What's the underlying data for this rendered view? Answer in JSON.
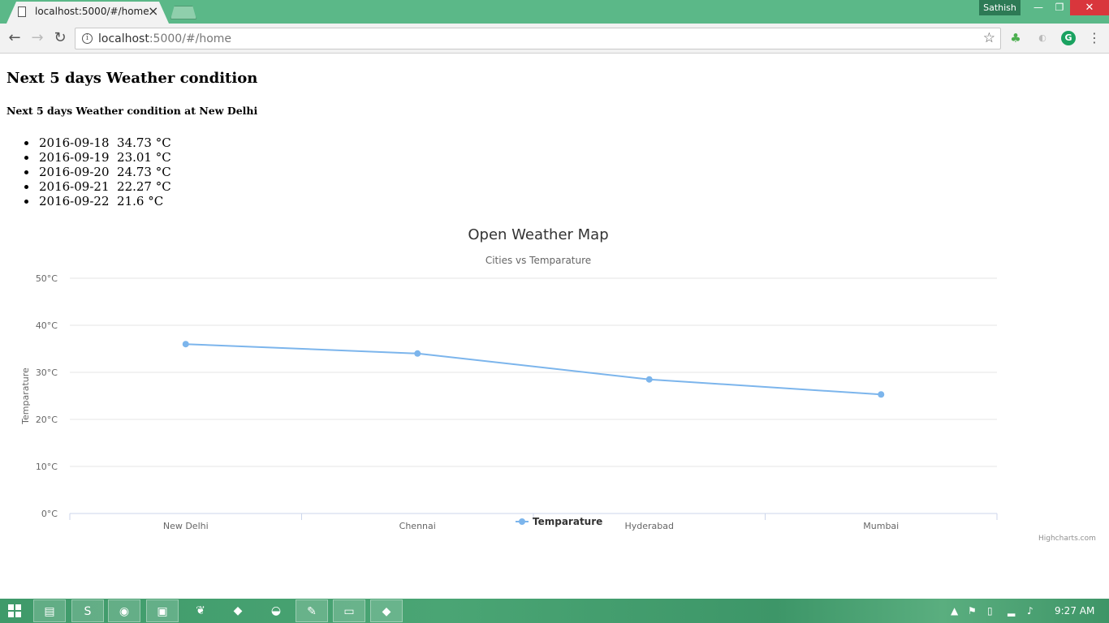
{
  "browser": {
    "tab_title": "localhost:5000/#/home",
    "profile_name": "Sathish",
    "url_host": "localhost",
    "url_rest": ":5000/#/home",
    "close_glyph": "✕",
    "min_glyph": "—",
    "max_glyph": "❐",
    "tab_close_glyph": "×"
  },
  "page": {
    "heading": "Next 5 days Weather condition",
    "subheading": "Next 5 days Weather condition at New Delhi",
    "forecast": [
      {
        "date": "2016-09-18",
        "temp": "34.73 °C"
      },
      {
        "date": "2016-09-19",
        "temp": "23.01 °C"
      },
      {
        "date": "2016-09-20",
        "temp": "24.73 °C"
      },
      {
        "date": "2016-09-21",
        "temp": "22.27 °C"
      },
      {
        "date": "2016-09-22",
        "temp": "21.6 °C"
      }
    ]
  },
  "chart_data": {
    "type": "line",
    "title": "Open Weather Map",
    "subtitle": "Cities vs Temparature",
    "ylabel": "Temparature",
    "xlabel": "",
    "categories": [
      "New Delhi",
      "Chennai",
      "Hyderabad",
      "Mumbai"
    ],
    "yticks": [
      "0°C",
      "10°C",
      "20°C",
      "30°C",
      "40°C",
      "50°C"
    ],
    "ylim": [
      0,
      50
    ],
    "grid": true,
    "legend": "bottom-center",
    "series": [
      {
        "name": "Temparature",
        "values": [
          36,
          34,
          28.5,
          25.3
        ],
        "color": "#7cb5ec"
      }
    ],
    "credits": "Highcharts.com"
  },
  "taskbar": {
    "clock": "9:27 AM"
  },
  "icons": {
    "info": "info-icon",
    "star": "star-icon",
    "back": "back-arrow-icon",
    "forward": "forward-arrow-icon",
    "reload": "reload-icon"
  }
}
